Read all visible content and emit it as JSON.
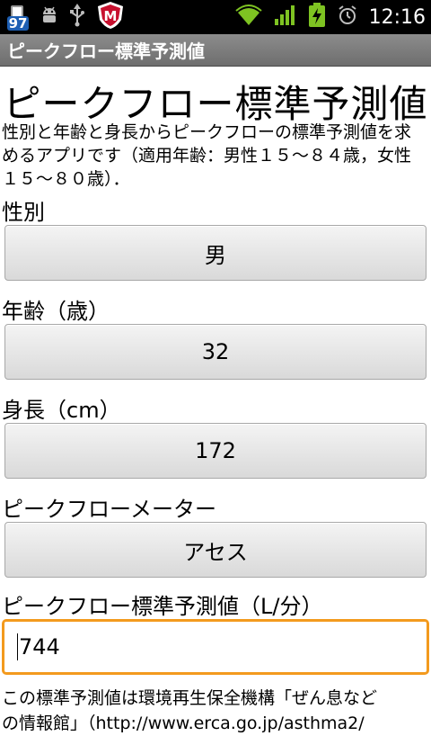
{
  "status_bar": {
    "battery_level": "97",
    "time": "12:16",
    "icons": [
      "battery-icon",
      "android-debug-icon",
      "usb-icon",
      "mcafee-icon",
      "wifi-icon",
      "signal-icon",
      "charging-icon",
      "alarm-icon"
    ],
    "colors": {
      "wifi": "#7ec322",
      "signal": "#7ec322",
      "charging": "#7ec322",
      "mcafee": "#c8102e"
    }
  },
  "app": {
    "title": "ピークフロー標準予測値"
  },
  "main": {
    "headline": "ピークフロー標準予測値",
    "description": "性別と年齢と身長からピークフローの標準予測値を求めるアプリです（適用年齢：男性１５～８４歳，女性１５～８０歳）．",
    "sex": {
      "label": "性別",
      "value": "男"
    },
    "age": {
      "label": "年齢（歳）",
      "value": "32"
    },
    "height": {
      "label": "身長（cm）",
      "value": "172"
    },
    "meter": {
      "label": "ピークフローメーター",
      "value": "アセス"
    },
    "result": {
      "label": "ピークフロー標準予測値（L/分）",
      "value": "744"
    },
    "footer_text": "この標準予測値は環境再生保全機構「ぜん息など",
    "footer_text_2": "の情報館」（http://www.erca.go.jp/asthma2/"
  },
  "colors": {
    "focus_border": "#f39a1e",
    "title_bar": "#7d7d7d"
  }
}
